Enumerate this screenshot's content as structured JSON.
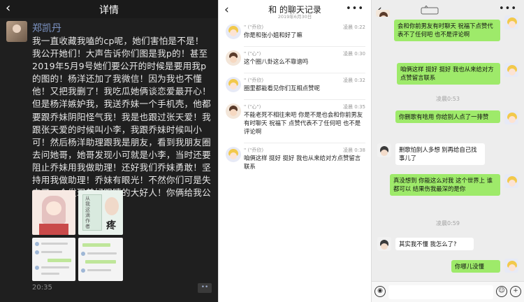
{
  "panel1": {
    "back": "‹",
    "title": "详情",
    "author": "郑凯丹",
    "body": "我一直收藏我嗑的cp呢，她们害怕是不是！我公开她们！大声告诉你们图是我p的！甚至2019年5月9号她们要公开的时候是要用我p的图的！杨洋还加了我微信！因为我也不懂他！又把我删了！我吃瓜她俩谈恋爱最开心！但是杨洋嫉妒我，我送乔妹一个手机壳，他都要跟乔妹阴阳怪气我！我是也跟过张天爱！我跟张天爱的时候叫小李，我跟乔妹时候叫小可！然后杨洋助理跟我是朋友，看到我朋友圈去问她哥，她哥发现小可就是小李，当时还要阻止乔妹用我做助理！还好我们乔妹勇敢！坚持用我做助理！乔妹有眼光！不然你们可是失去了一个发现美好眼睛的大好人！你俩给我公开！",
    "img2_caption": "从我这滴作者",
    "img2_word": "疼",
    "time": "20:35",
    "more": "••"
  },
  "panel2": {
    "back": "‹",
    "title": "和 的聊天记录",
    "date": "2019年6月30日",
    "dots": "•••",
    "records": [
      {
        "name": "\" (\"乔欣)",
        "time": "凌晨 0:22",
        "text": "你是和张小姐和好了嘛"
      },
      {
        "name": "\" (\"心\")",
        "time": "凌晨 0:30",
        "text": "这个圈八卦这么不靠谱吗"
      },
      {
        "name": "\" (\"乔欣)",
        "time": "凌晨 0:32",
        "text": "圈里都能看见你们互相点赞呢"
      },
      {
        "name": "\" (\"心\")",
        "time": "凌晨 0:35",
        "text": "不能老死不相往来吧 你是不是也会和你前男友有时聊天 祝福下 点赞代表不了任何吧 也不是评论啊"
      },
      {
        "name": "\" (\"乔欣)",
        "time": "凌晨 0:38",
        "text": "咱俩这样 挺好 挺好 我也从来给对方点赞留言联系"
      }
    ]
  },
  "panel3": {
    "back": "‹",
    "dots": "•••",
    "top_bubble": "会和你前男友有时聊天 祝福下点赞代表不了任何吧 也不是评论啊",
    "bubbles": [
      {
        "side": "right",
        "text": "咱俩这样 挺好 挺好 我也从来给对方点赞留言联系"
      },
      {
        "type": "time",
        "text": "凌晨0:53"
      },
      {
        "side": "right",
        "text": "你删歌有啥用 你给别人点了一排赞"
      },
      {
        "side": "left",
        "text": "删歌怕别人多想 别再给自己找事儿了"
      },
      {
        "side": "right",
        "text": "真没想到 你能这么对我 这个世界上 谁都可以 结果伤我最深的是你"
      },
      {
        "type": "time",
        "text": "凌晨0:59"
      },
      {
        "side": "left",
        "text": "其实我不懂 我怎么了?"
      },
      {
        "side": "right",
        "text": "你哪儿没懂"
      }
    ],
    "bottom": {
      "voice": "◉",
      "emoji": "☺",
      "plus": "+"
    }
  }
}
